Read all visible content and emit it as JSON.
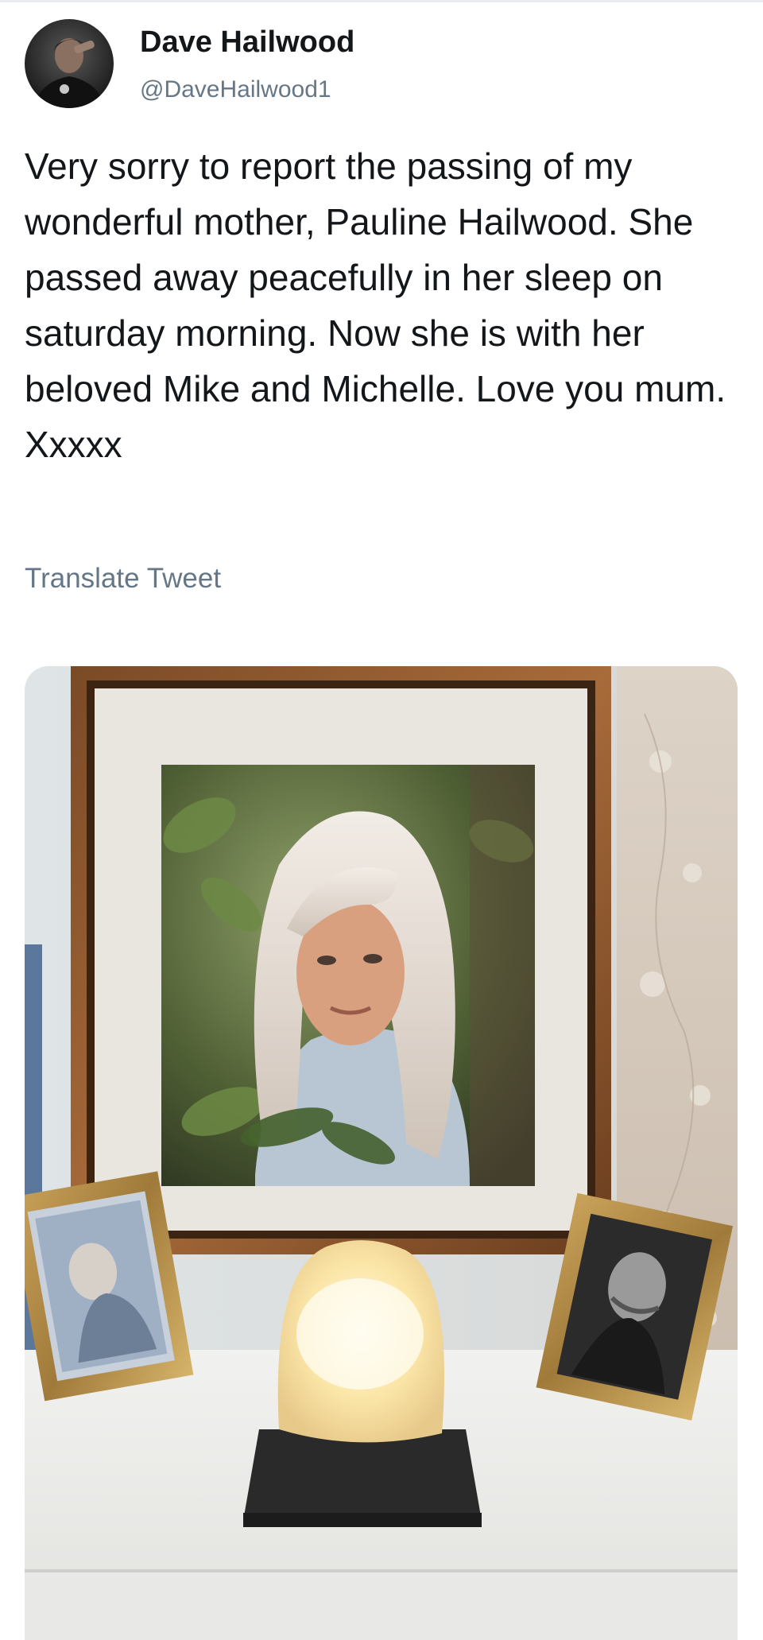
{
  "tweet": {
    "author_name": "Dave Hailwood",
    "author_handle": "@DaveHailwood1",
    "text": "Very sorry to report the passing of my wonderful mother, Pauline Hailwood. She passed away peacefully in her sleep on saturday morning. Now she is with her beloved Mike and Michelle. Love you mum. Xxxxx",
    "translate_label": "Translate Tweet"
  },
  "colors": {
    "primary_text": "#14171a",
    "secondary_text": "#657786",
    "background": "#ffffff"
  }
}
